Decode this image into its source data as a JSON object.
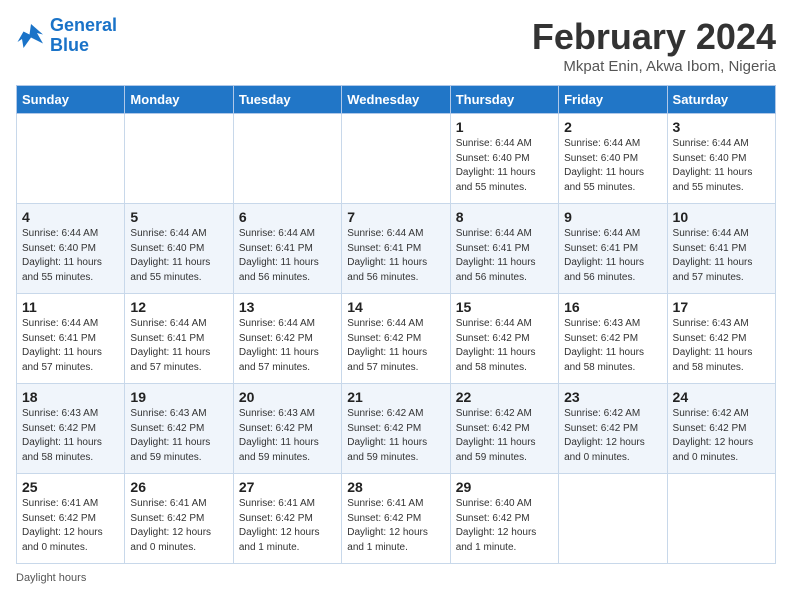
{
  "header": {
    "logo_general": "General",
    "logo_blue": "Blue",
    "month_title": "February 2024",
    "location": "Mkpat Enin, Akwa Ibom, Nigeria"
  },
  "days_of_week": [
    "Sunday",
    "Monday",
    "Tuesday",
    "Wednesday",
    "Thursday",
    "Friday",
    "Saturday"
  ],
  "weeks": [
    [
      {
        "day": "",
        "info": ""
      },
      {
        "day": "",
        "info": ""
      },
      {
        "day": "",
        "info": ""
      },
      {
        "day": "",
        "info": ""
      },
      {
        "day": "1",
        "info": "Sunrise: 6:44 AM\nSunset: 6:40 PM\nDaylight: 11 hours\nand 55 minutes."
      },
      {
        "day": "2",
        "info": "Sunrise: 6:44 AM\nSunset: 6:40 PM\nDaylight: 11 hours\nand 55 minutes."
      },
      {
        "day": "3",
        "info": "Sunrise: 6:44 AM\nSunset: 6:40 PM\nDaylight: 11 hours\nand 55 minutes."
      }
    ],
    [
      {
        "day": "4",
        "info": "Sunrise: 6:44 AM\nSunset: 6:40 PM\nDaylight: 11 hours\nand 55 minutes."
      },
      {
        "day": "5",
        "info": "Sunrise: 6:44 AM\nSunset: 6:40 PM\nDaylight: 11 hours\nand 55 minutes."
      },
      {
        "day": "6",
        "info": "Sunrise: 6:44 AM\nSunset: 6:41 PM\nDaylight: 11 hours\nand 56 minutes."
      },
      {
        "day": "7",
        "info": "Sunrise: 6:44 AM\nSunset: 6:41 PM\nDaylight: 11 hours\nand 56 minutes."
      },
      {
        "day": "8",
        "info": "Sunrise: 6:44 AM\nSunset: 6:41 PM\nDaylight: 11 hours\nand 56 minutes."
      },
      {
        "day": "9",
        "info": "Sunrise: 6:44 AM\nSunset: 6:41 PM\nDaylight: 11 hours\nand 56 minutes."
      },
      {
        "day": "10",
        "info": "Sunrise: 6:44 AM\nSunset: 6:41 PM\nDaylight: 11 hours\nand 57 minutes."
      }
    ],
    [
      {
        "day": "11",
        "info": "Sunrise: 6:44 AM\nSunset: 6:41 PM\nDaylight: 11 hours\nand 57 minutes."
      },
      {
        "day": "12",
        "info": "Sunrise: 6:44 AM\nSunset: 6:41 PM\nDaylight: 11 hours\nand 57 minutes."
      },
      {
        "day": "13",
        "info": "Sunrise: 6:44 AM\nSunset: 6:42 PM\nDaylight: 11 hours\nand 57 minutes."
      },
      {
        "day": "14",
        "info": "Sunrise: 6:44 AM\nSunset: 6:42 PM\nDaylight: 11 hours\nand 57 minutes."
      },
      {
        "day": "15",
        "info": "Sunrise: 6:44 AM\nSunset: 6:42 PM\nDaylight: 11 hours\nand 58 minutes."
      },
      {
        "day": "16",
        "info": "Sunrise: 6:43 AM\nSunset: 6:42 PM\nDaylight: 11 hours\nand 58 minutes."
      },
      {
        "day": "17",
        "info": "Sunrise: 6:43 AM\nSunset: 6:42 PM\nDaylight: 11 hours\nand 58 minutes."
      }
    ],
    [
      {
        "day": "18",
        "info": "Sunrise: 6:43 AM\nSunset: 6:42 PM\nDaylight: 11 hours\nand 58 minutes."
      },
      {
        "day": "19",
        "info": "Sunrise: 6:43 AM\nSunset: 6:42 PM\nDaylight: 11 hours\nand 59 minutes."
      },
      {
        "day": "20",
        "info": "Sunrise: 6:43 AM\nSunset: 6:42 PM\nDaylight: 11 hours\nand 59 minutes."
      },
      {
        "day": "21",
        "info": "Sunrise: 6:42 AM\nSunset: 6:42 PM\nDaylight: 11 hours\nand 59 minutes."
      },
      {
        "day": "22",
        "info": "Sunrise: 6:42 AM\nSunset: 6:42 PM\nDaylight: 11 hours\nand 59 minutes."
      },
      {
        "day": "23",
        "info": "Sunrise: 6:42 AM\nSunset: 6:42 PM\nDaylight: 12 hours\nand 0 minutes."
      },
      {
        "day": "24",
        "info": "Sunrise: 6:42 AM\nSunset: 6:42 PM\nDaylight: 12 hours\nand 0 minutes."
      }
    ],
    [
      {
        "day": "25",
        "info": "Sunrise: 6:41 AM\nSunset: 6:42 PM\nDaylight: 12 hours\nand 0 minutes."
      },
      {
        "day": "26",
        "info": "Sunrise: 6:41 AM\nSunset: 6:42 PM\nDaylight: 12 hours\nand 0 minutes."
      },
      {
        "day": "27",
        "info": "Sunrise: 6:41 AM\nSunset: 6:42 PM\nDaylight: 12 hours\nand 1 minute."
      },
      {
        "day": "28",
        "info": "Sunrise: 6:41 AM\nSunset: 6:42 PM\nDaylight: 12 hours\nand 1 minute."
      },
      {
        "day": "29",
        "info": "Sunrise: 6:40 AM\nSunset: 6:42 PM\nDaylight: 12 hours\nand 1 minute."
      },
      {
        "day": "",
        "info": ""
      },
      {
        "day": "",
        "info": ""
      }
    ]
  ],
  "footer": {
    "daylight_label": "Daylight hours"
  }
}
